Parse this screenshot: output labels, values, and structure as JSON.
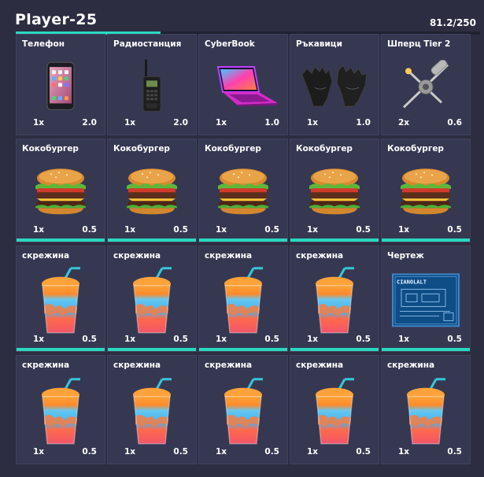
{
  "header": {
    "player_name": "Player-25",
    "weight_text": "81.2/250",
    "capacity_fraction": 0.312
  },
  "colors": {
    "background": "#2c2d40",
    "slot": "#363852",
    "accent": "#2ad8c0"
  },
  "items": [
    {
      "name": "Телефон",
      "qty": "1x",
      "weight": "2.0",
      "icon": "smartphone-icon"
    },
    {
      "name": "Радиостанция",
      "qty": "1x",
      "weight": "2.0",
      "icon": "walkie-talkie-icon"
    },
    {
      "name": "CyberBook",
      "qty": "1x",
      "weight": "1.0",
      "icon": "laptop-icon"
    },
    {
      "name": "Ръкавици",
      "qty": "1x",
      "weight": "1.0",
      "icon": "gloves-icon"
    },
    {
      "name": "Шперц Tier 2",
      "qty": "2x",
      "weight": "0.6",
      "icon": "lockpick-icon"
    },
    {
      "name": "Кокобургер",
      "qty": "1x",
      "weight": "0.5",
      "icon": "burger-icon"
    },
    {
      "name": "Кокобургер",
      "qty": "1x",
      "weight": "0.5",
      "icon": "burger-icon"
    },
    {
      "name": "Кокобургер",
      "qty": "1x",
      "weight": "0.5",
      "icon": "burger-icon"
    },
    {
      "name": "Кокобургер",
      "qty": "1x",
      "weight": "0.5",
      "icon": "burger-icon"
    },
    {
      "name": "Кокобургер",
      "qty": "1x",
      "weight": "0.5",
      "icon": "burger-icon"
    },
    {
      "name": "скрежина",
      "qty": "1x",
      "weight": "0.5",
      "icon": "slushie-icon"
    },
    {
      "name": "скрежина",
      "qty": "1x",
      "weight": "0.5",
      "icon": "slushie-icon"
    },
    {
      "name": "скрежина",
      "qty": "1x",
      "weight": "0.5",
      "icon": "slushie-icon"
    },
    {
      "name": "скрежина",
      "qty": "1x",
      "weight": "0.5",
      "icon": "slushie-icon"
    },
    {
      "name": "Чертеж",
      "qty": "1x",
      "weight": "0.5",
      "icon": "blueprint-icon",
      "blueprint_text": "CIANOLALT"
    },
    {
      "name": "скрежина",
      "qty": "1x",
      "weight": "0.5",
      "icon": "slushie-icon"
    },
    {
      "name": "скрежина",
      "qty": "1x",
      "weight": "0.5",
      "icon": "slushie-icon"
    },
    {
      "name": "скрежина",
      "qty": "1x",
      "weight": "0.5",
      "icon": "slushie-icon"
    },
    {
      "name": "скрежина",
      "qty": "1x",
      "weight": "0.5",
      "icon": "slushie-icon"
    },
    {
      "name": "скрежина",
      "qty": "1x",
      "weight": "0.5",
      "icon": "slushie-icon"
    }
  ],
  "item_bars": [
    false,
    false,
    false,
    false,
    false,
    true,
    true,
    true,
    true,
    true,
    true,
    true,
    true,
    true,
    true,
    false,
    false,
    false,
    false,
    false
  ]
}
